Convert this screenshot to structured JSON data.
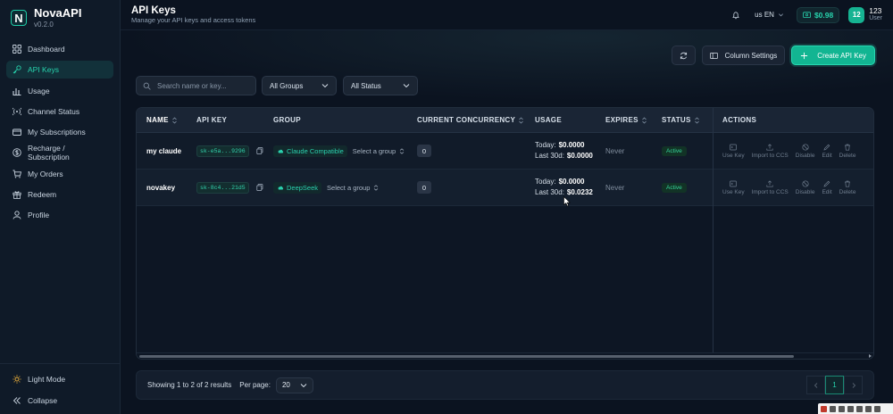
{
  "brand": {
    "name": "NovaAPI",
    "version": "v0.2.0",
    "logo_letter": "N"
  },
  "sidebar": {
    "items": [
      {
        "label": "Dashboard",
        "icon": "grid-icon"
      },
      {
        "label": "API Keys",
        "icon": "key-icon",
        "active": true
      },
      {
        "label": "Usage",
        "icon": "bar-chart-icon"
      },
      {
        "label": "Channel Status",
        "icon": "signal-icon"
      },
      {
        "label": "My Subscriptions",
        "icon": "card-icon"
      },
      {
        "label": "Recharge / Subscription",
        "icon": "dollar-icon"
      },
      {
        "label": "My Orders",
        "icon": "cart-icon"
      },
      {
        "label": "Redeem",
        "icon": "gift-icon"
      },
      {
        "label": "Profile",
        "icon": "user-icon"
      }
    ],
    "bottom": {
      "light_mode": "Light Mode",
      "collapse": "Collapse"
    }
  },
  "header": {
    "title": "API Keys",
    "subtitle": "Manage your API keys and access tokens",
    "lang": "us EN",
    "balance": "$0.98",
    "user": {
      "avatar": "12",
      "name": "123",
      "role": "User"
    }
  },
  "toolbar": {
    "column_settings": "Column Settings",
    "create": "Create API Key"
  },
  "filters": {
    "search_placeholder": "Search name or key...",
    "groups": "All Groups",
    "status": "All Status"
  },
  "table": {
    "headers": {
      "name": "NAME",
      "key": "API KEY",
      "group": "GROUP",
      "concurrency": "CURRENT CONCURRENCY",
      "usage": "USAGE",
      "expires": "EXPIRES",
      "status": "STATUS",
      "actions": "ACTIONS"
    },
    "rows": [
      {
        "name": "my claude",
        "key": "sk-e5a...9296",
        "group_tag": "Claude Compatible",
        "group_select": "Select a group",
        "concurrency": "0",
        "today_label": "Today:",
        "today": "$0.0000",
        "last30_label": "Last 30d:",
        "last30": "$0.0000",
        "expires": "Never",
        "status": "Active"
      },
      {
        "name": "novakey",
        "key": "sk-8c4...21d5",
        "group_tag": "DeepSeek",
        "group_select": "Select a group",
        "concurrency": "0",
        "today_label": "Today:",
        "today": "$0.0000",
        "last30_label": "Last 30d:",
        "last30": "$0.0232",
        "expires": "Never",
        "status": "Active"
      }
    ],
    "actions": {
      "use_key": "Use Key",
      "import": "Import to CCS",
      "disable": "Disable",
      "edit": "Edit",
      "delete": "Delete"
    }
  },
  "pager": {
    "showing": "Showing 1 to 2 of 2 results",
    "per_page_label": "Per page:",
    "per_page": "20",
    "current_page": "1"
  },
  "colors": {
    "accent": "#27d3ad",
    "bg": "#0b1320",
    "sidebar": "#0f1a28",
    "active_badge": "#34d399"
  }
}
